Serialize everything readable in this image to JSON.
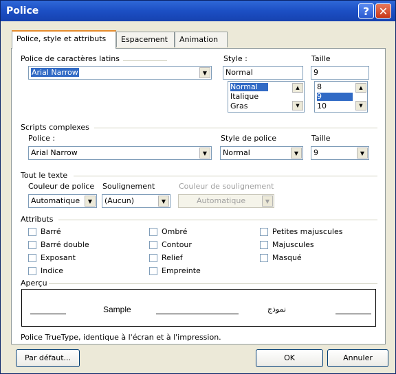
{
  "window": {
    "title": "Police",
    "help_glyph": "?",
    "close_glyph": "✕"
  },
  "tabs": [
    {
      "label": "Police, style et attributs"
    },
    {
      "label": "Espacement"
    },
    {
      "label": "Animation"
    }
  ],
  "latin": {
    "font_label": "Police de caractères latins",
    "font_value": "Arial Narrow",
    "style_label": "Style :",
    "style_value": "Normal",
    "style_options": [
      "Normal",
      "Italique",
      "Gras"
    ],
    "size_label": "Taille",
    "size_value": "9",
    "size_options": [
      "8",
      "9",
      "10"
    ]
  },
  "complex": {
    "group_label": "Scripts complexes",
    "font_label": "Police :",
    "font_value": "Arial Narrow",
    "style_label": "Style de police",
    "style_value": "Normal",
    "size_label": "Taille",
    "size_value": "9"
  },
  "all_text": {
    "group_label": "Tout le texte",
    "color_label": "Couleur de police",
    "color_value": "Automatique",
    "underline_label": "Soulignement",
    "underline_value": "(Aucun)",
    "underline_color_label": "Couleur de soulignement",
    "underline_color_value": "Automatique"
  },
  "attributes": {
    "group_label": "Attributs",
    "items": [
      {
        "label": "Barré"
      },
      {
        "label": "Barré double"
      },
      {
        "label": "Exposant"
      },
      {
        "label": "Indice"
      },
      {
        "label": "Ombré"
      },
      {
        "label": "Contour"
      },
      {
        "label": "Relief"
      },
      {
        "label": "Empreinte"
      },
      {
        "label": "Petites majuscules"
      },
      {
        "label": "Majuscules"
      },
      {
        "label": "Masqué"
      }
    ]
  },
  "preview": {
    "group_label": "Aperçu",
    "sample": "Sample",
    "sample_arabic": "نموذج",
    "description": "Police TrueType, identique à l'écran et à l'impression."
  },
  "buttons": {
    "default": "Par défaut...",
    "ok": "OK",
    "cancel": "Annuler"
  },
  "colors": {
    "titlebar": "#1c4fc4",
    "selection": "#316ac5",
    "dialog_bg": "#ece9d8"
  }
}
